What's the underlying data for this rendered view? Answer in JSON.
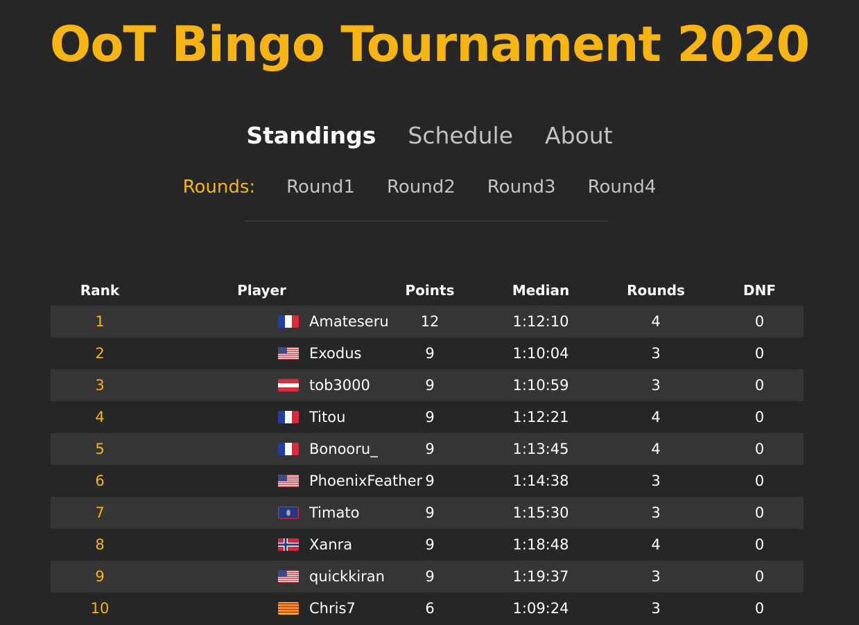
{
  "header": {
    "title": "OoT Bingo Tournament 2020"
  },
  "nav": {
    "items": [
      {
        "label": "Standings",
        "active": true
      },
      {
        "label": "Schedule",
        "active": false
      },
      {
        "label": "About",
        "active": false
      }
    ]
  },
  "rounds": {
    "label": "Rounds:",
    "items": [
      "Round1",
      "Round2",
      "Round3",
      "Round4"
    ]
  },
  "table": {
    "columns": [
      "Rank",
      "Player",
      "Points",
      "Median",
      "Rounds",
      "DNF"
    ],
    "rows": [
      {
        "rank": "1",
        "flag": "france-flag-icon",
        "player": "Amateseru",
        "points": "12",
        "median": "1:12:10",
        "rounds": "4",
        "dnf": "0"
      },
      {
        "rank": "2",
        "flag": "usa-flag-icon",
        "player": "Exodus",
        "points": "9",
        "median": "1:10:04",
        "rounds": "3",
        "dnf": "0"
      },
      {
        "rank": "3",
        "flag": "austria-flag-icon",
        "player": "tob3000",
        "points": "9",
        "median": "1:10:59",
        "rounds": "3",
        "dnf": "0"
      },
      {
        "rank": "4",
        "flag": "france-flag-icon",
        "player": "Titou",
        "points": "9",
        "median": "1:12:21",
        "rounds": "4",
        "dnf": "0"
      },
      {
        "rank": "5",
        "flag": "france-flag-icon",
        "player": "Bonooru_",
        "points": "9",
        "median": "1:13:45",
        "rounds": "4",
        "dnf": "0"
      },
      {
        "rank": "6",
        "flag": "usa-flag-icon",
        "player": "PhoenixFeather",
        "points": "9",
        "median": "1:14:38",
        "rounds": "3",
        "dnf": "0"
      },
      {
        "rank": "7",
        "flag": "guam-flag-icon",
        "player": "Timato",
        "points": "9",
        "median": "1:15:30",
        "rounds": "3",
        "dnf": "0"
      },
      {
        "rank": "8",
        "flag": "norway-flag-icon",
        "player": "Xanra",
        "points": "9",
        "median": "1:18:48",
        "rounds": "4",
        "dnf": "0"
      },
      {
        "rank": "9",
        "flag": "usa-flag-icon",
        "player": "quickkiran",
        "points": "9",
        "median": "1:19:37",
        "rounds": "3",
        "dnf": "0"
      },
      {
        "rank": "10",
        "flag": "catalonia-flag-icon",
        "player": "Chris7",
        "points": "6",
        "median": "1:09:24",
        "rounds": "3",
        "dnf": "0"
      }
    ]
  },
  "colors": {
    "background": "#262626",
    "accent": "#f7b514",
    "row_alt": "#353535",
    "muted_link": "#c3c3c3"
  }
}
